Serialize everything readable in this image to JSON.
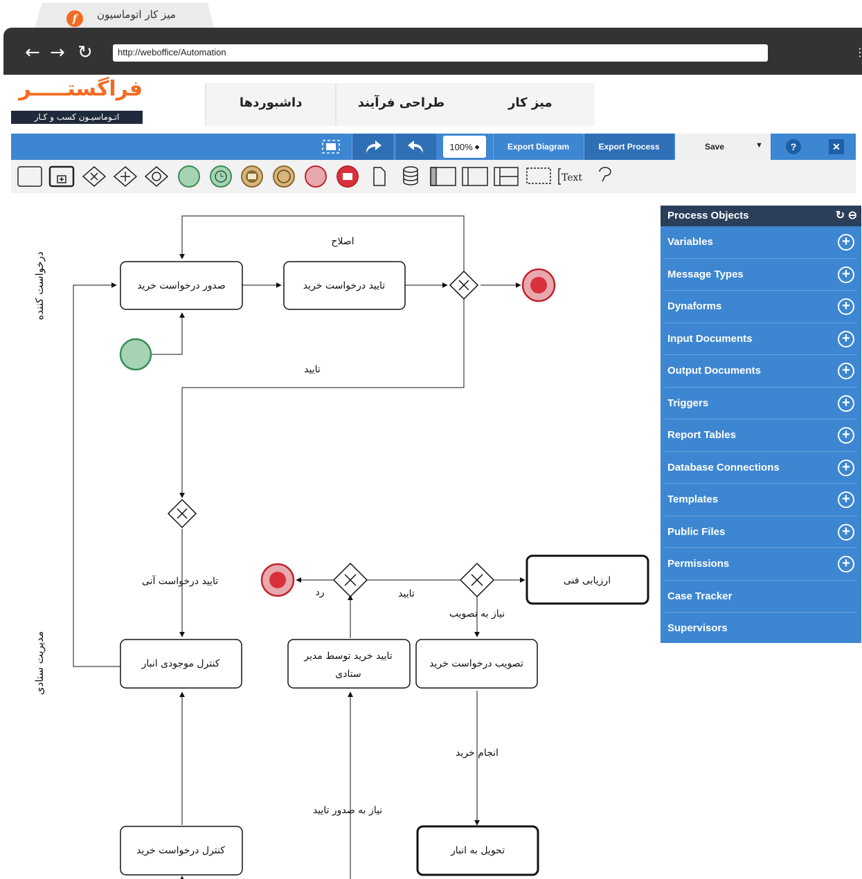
{
  "browser": {
    "tab_title": "میز کار اتوماسیون",
    "url": "http://weboffice/Automation"
  },
  "header": {
    "logo_text": "فراگستـــــر",
    "logo_sub": "اتـوماسیـون کسب و کـار",
    "nav": [
      "داشبوردها",
      "طراحی فرآیند",
      "میز کار"
    ]
  },
  "toolbar": {
    "zoom": "100%",
    "export_diagram": "Export Diagram",
    "export_process": "Export Process",
    "save": "Save",
    "help": "?",
    "close": "✕"
  },
  "palette": {
    "text_tool": "Text"
  },
  "panel": {
    "title": "Process Objects",
    "items": [
      {
        "label": "Variables",
        "add": true
      },
      {
        "label": "Message Types",
        "add": true
      },
      {
        "label": "Dynaforms",
        "add": true
      },
      {
        "label": "Input Documents",
        "add": true
      },
      {
        "label": "Output Documents",
        "add": true
      },
      {
        "label": "Triggers",
        "add": true
      },
      {
        "label": "Report Tables",
        "add": true
      },
      {
        "label": "Database Connections",
        "add": true
      },
      {
        "label": "Templates",
        "add": true
      },
      {
        "label": "Public Files",
        "add": true
      },
      {
        "label": "Permissions",
        "add": true
      },
      {
        "label": "Case Tracker",
        "add": false
      },
      {
        "label": "Supervisors",
        "add": false
      }
    ]
  },
  "diagram": {
    "lanes": [
      "درخواست کننده",
      "مدیریت ستادی"
    ],
    "tasks": {
      "t1": "صدور درخواست خرید",
      "t2": "تایید درخواست خرید",
      "t3": "ارزیابی فنی",
      "t4": "کنترل موجودی انبار",
      "t5a": "تایید خرید توسط مدیر",
      "t5b": "ستادی",
      "t6": "تصویب درخواست خرید",
      "t7": "کنترل درخواست خرید",
      "t8": "تحویل به انبار"
    },
    "labels": {
      "l1": "اصلاح",
      "l2": "تایید",
      "l3": "تایید درخواست آنی",
      "l4": "رد",
      "l5": "تایید",
      "l6": "نیاز به تصویب",
      "l7": "انجام خرید",
      "l8": "نیاز به صدور تایید"
    }
  }
}
